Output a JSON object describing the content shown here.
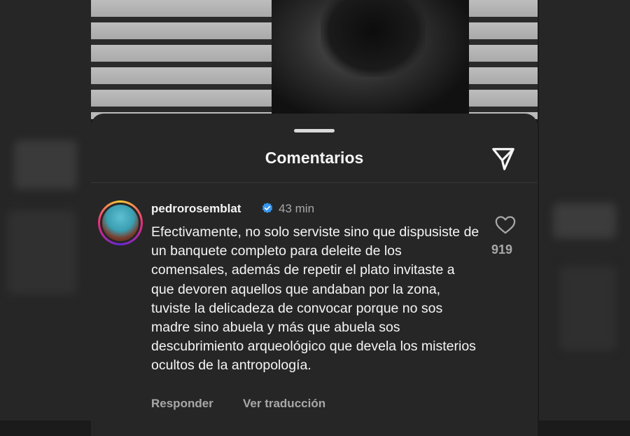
{
  "sheet": {
    "title": "Comentarios"
  },
  "comment": {
    "username": "pedrorosemblat",
    "verified": true,
    "time": "43 min",
    "text": "Efectivamente, no solo serviste sino que dispusiste de un banquete completo para deleite de los comensales, además de repetir el plato invitaste a que devoren aquellos que andaban por la zona, tuviste la delicadeza de convocar porque no sos madre sino abuela y más que abuela sos descubrimiento arqueológico que devela los misterios ocultos de la antropología.",
    "likes": "919",
    "reply_label": "Responder",
    "translate_label": "Ver traducción"
  },
  "icons": {
    "share": "paper-plane-icon",
    "like": "heart-icon",
    "verified": "verified-badge-icon"
  },
  "colors": {
    "sheet_bg": "#262626",
    "text_primary": "#f5f5f5",
    "text_secondary": "#a8a8a8",
    "verified_blue": "#3897f0"
  }
}
